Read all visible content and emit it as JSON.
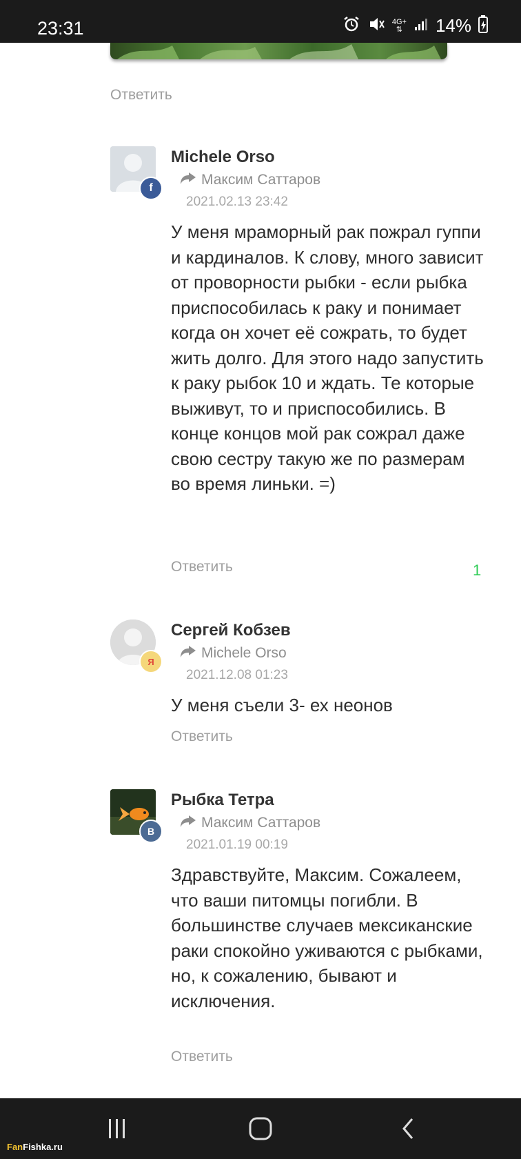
{
  "status_bar": {
    "time": "23:31",
    "battery": "14%",
    "network": "4G+"
  },
  "top": {
    "reply_label": "Ответить"
  },
  "comments": [
    {
      "author": "Michele Orso",
      "reply_to": "Максим Саттаров",
      "date": "2021.02.13 23:42",
      "badge": "f",
      "text": "У меня мраморный рак пожрал гуппи и кардиналов. К слову, много зависит от проворности рыбки - если рыбка приспособилась к раку и понимает когда он хочет её сожрать, то будет жить долго. Для этого надо запустить к раку рыбок 10 и ждать. Те которые выживут, то и приспособились. В конце концов мой рак сожрал даже свою сестру такую же по размерам во время линьки. =)",
      "reply_label": "Ответить",
      "likes": "1"
    },
    {
      "author": "Сергей Кобзев",
      "reply_to": "Michele Orso",
      "date": "2021.12.08 01:23",
      "badge": "Я",
      "text": "У меня съели 3- ех неонов",
      "reply_label": "Ответить"
    },
    {
      "author": "Рыбка Тетра",
      "reply_to": "Максим Саттаров",
      "date": "2021.01.19 00:19",
      "badge": "B",
      "text": "Здравствуйте, Максим. Сожалеем, что ваши питомцы погибли. В большинстве случаев мексиканские раки спокойно уживаются с рыбками, но, к сожалению, бывают и исключения.",
      "reply_label": "Ответить"
    }
  ],
  "watermark": {
    "part1": "Fan",
    "part2": "Fishka.ru"
  },
  "colors": {
    "status_bar": "#1b1b1b",
    "likes": "#2ecc55",
    "muted": "#9e9e9e"
  }
}
